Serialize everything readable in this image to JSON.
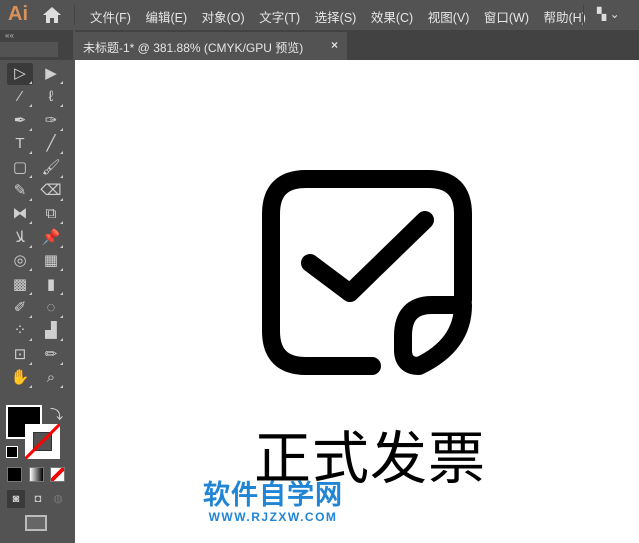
{
  "app": {
    "logo": "Ai",
    "workspace_icon": "▚ ⌄"
  },
  "menus": [
    "文件(F)",
    "编辑(E)",
    "对象(O)",
    "文字(T)",
    "选择(S)",
    "效果(C)",
    "视图(V)",
    "窗口(W)",
    "帮助(H)"
  ],
  "document_tab": {
    "title": "未标题-1* @ 381.88% (CMYK/GPU 预览)",
    "close": "×"
  },
  "toolbar": {
    "collapse": "««",
    "tools": [
      {
        "name": "selection-tool",
        "glyph": "▷"
      },
      {
        "name": "direct-selection-tool",
        "glyph": "▶"
      },
      {
        "name": "magic-wand-tool",
        "glyph": "⁄"
      },
      {
        "name": "lasso-tool",
        "glyph": "ℓ"
      },
      {
        "name": "pen-tool",
        "glyph": "✒"
      },
      {
        "name": "curvature-tool",
        "glyph": "✑"
      },
      {
        "name": "type-tool",
        "glyph": "T"
      },
      {
        "name": "line-segment-tool",
        "glyph": "╱"
      },
      {
        "name": "rectangle-tool",
        "glyph": "▢"
      },
      {
        "name": "paintbrush-tool",
        "glyph": "🖌"
      },
      {
        "name": "shaper-tool",
        "glyph": "✎"
      },
      {
        "name": "eraser-tool",
        "glyph": "⌫"
      },
      {
        "name": "reflect-tool",
        "glyph": "⧓"
      },
      {
        "name": "scale-tool",
        "glyph": "⧉"
      },
      {
        "name": "warp-tool",
        "glyph": "ﻼ"
      },
      {
        "name": "puppet-warp-tool",
        "glyph": "📌"
      },
      {
        "name": "shape-builder-tool",
        "glyph": "◎"
      },
      {
        "name": "perspective-grid-tool",
        "glyph": "▦"
      },
      {
        "name": "mesh-tool",
        "glyph": "▩"
      },
      {
        "name": "gradient-tool",
        "glyph": "▮"
      },
      {
        "name": "eyedropper-tool",
        "glyph": "✐"
      },
      {
        "name": "blend-tool",
        "glyph": "◌"
      },
      {
        "name": "symbol-sprayer-tool",
        "glyph": "⁘"
      },
      {
        "name": "column-graph-tool",
        "glyph": "▟"
      },
      {
        "name": "artboard-tool",
        "glyph": "⊡"
      },
      {
        "name": "slice-tool",
        "glyph": "✏"
      },
      {
        "name": "hand-tool",
        "glyph": "✋"
      },
      {
        "name": "zoom-tool",
        "glyph": "⌕"
      }
    ]
  },
  "colors": {
    "fill": "#000000",
    "stroke": "none",
    "accent": "#2185d6"
  },
  "artwork": {
    "title": "正式发票"
  },
  "watermark": {
    "line1": "软件自学网",
    "line2": "WWW.RJZXW.COM"
  }
}
